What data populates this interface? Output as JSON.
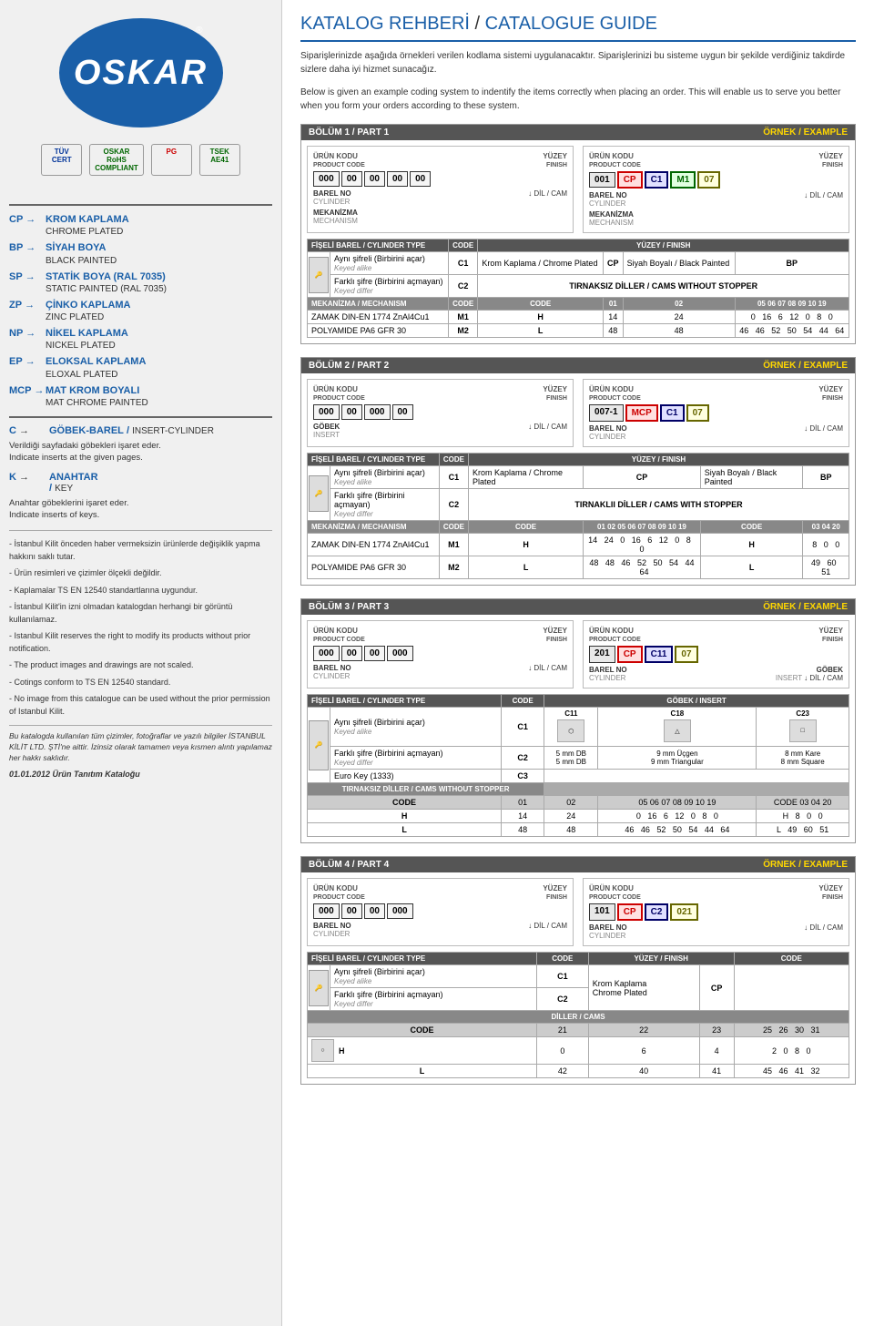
{
  "sidebar": {
    "logo": "OSKAR",
    "logo_reg": "®",
    "certs": [
      {
        "label": "TÜV\nCERT",
        "class": "tuv"
      },
      {
        "label": "OSKAR\nRoHS\nCOMPLIANT",
        "class": "rohs"
      },
      {
        "label": "PG",
        "class": "pg"
      },
      {
        "label": "TSEK\nAE41",
        "class": "tsek"
      }
    ],
    "abbreviations": [
      {
        "code": "CP",
        "tr": "KROM KAPLAMA",
        "en": "CHROME PLATED"
      },
      {
        "code": "BP",
        "tr": "SİYAH BOYA",
        "en": "BLACK PAINTED"
      },
      {
        "code": "SP",
        "tr": "STATİK BOYA (RAL 7035)",
        "en": "STATIC PAINTED (RAL 7035)"
      },
      {
        "code": "ZP",
        "tr": "ÇİNKO KAPLAMA",
        "en": "ZINC PLATED"
      },
      {
        "code": "NP",
        "tr": "NİKEL KAPLAMA",
        "en": "NICKEL PLATED"
      },
      {
        "code": "EP",
        "tr": "ELOKSAL KAPLAMA",
        "en": "ELOXAL PLATED"
      },
      {
        "code": "MCP",
        "tr": "MAT KROM BOYALI",
        "en": "MAT CHROME PAINTED"
      }
    ],
    "insert_code": "C",
    "insert_tr": "GÖBEK-BAREL",
    "insert_en": "INSERT-CYLINDER",
    "insert_desc_tr": "Verildiği sayfadaki göbekleri işaret eder.",
    "insert_desc_en": "Indicate inserts at the given pages.",
    "key_code": "K",
    "key_tr": "ANAHTAR",
    "key_slash": "/",
    "key_en": "KEY",
    "key_desc_tr": "Anahtar göbeklerini işaret eder.",
    "key_desc_en": "Indicate inserts of keys.",
    "info_lines": [
      "- İstanbul Kilit önceden haber vermeksizin ürünlerde değişiklik yapma hakkını saklı tutar.",
      "- Ürün resimleri ve çizimler ölçekli değildir.",
      "- Kaplamalar TS EN 12540 standartlarına uygundur.",
      "- İstanbul Kilit'in izni olmadan katalogdan herhangi bir görüntü kullanılamaz.",
      "- Istanbul Kilit reserves the right to modify its products without prior notification.",
      "- The product images and drawings are not scaled.",
      "- Cotings conform to TS EN 12540 standard.",
      "- No image from this catalogue can be used without the prior permission of Istanbul Kilit."
    ],
    "footer_italic": "Bu katalogda kullanılan tüm çizimler, fotoğraflar ve yazılı bilgiler İSTANBUL KİLİT LTD. ŞTİ'ne aittir. İzinsiz olarak tamamen veya kısmen alıntı yapılamaz her hakkı saklıdır.",
    "footer_date": "01.01.2012 Ürün Tanıtım Kataloğu"
  },
  "main": {
    "title": "KATALOG REHBERİ",
    "title_slash": "/",
    "title_en": "CATALOGUE GUIDE",
    "intro1": "Siparişlerinizde aşağıda örnekleri verilen kodlama sistemi uygulanacaktır. Siparişlerinizi bu sisteme uygun bir şekilde verdiğiniz takdirde sizlere daha iyi hizmet sunacağız.",
    "intro2": "Below is given an example coding system to indentify the items correctly when placing an order. This will enable us to serve you better when you form your orders according to these system.",
    "sections": [
      {
        "id": "bolum1",
        "title": "BÖLÜM 1 / PART 1",
        "example_label": "ÖRNEK / EXAMPLE",
        "left_diagram": {
          "product_code_label": "ÜRÜN KODU",
          "product_code_en": "PRODUCT CODE",
          "finish_label": "YÜZEY",
          "finish_en": "FINISH",
          "boxes": [
            "000",
            "00",
            "00",
            "00",
            "00"
          ],
          "cylinder_label": "BAREL NO",
          "cylinder_en": "CYLINDER",
          "dil_label": "DİL / CAM",
          "mechanism_label": "MEKANİZMA",
          "mechanism_en": "MECHANISM"
        },
        "right_diagram": {
          "product_code_label": "ÜRÜN KODU",
          "product_code_en": "PRODUCT CODE",
          "finish_label": "YÜZEY",
          "finish_en": "FINISH",
          "boxes": [
            "001",
            "CP",
            "C1",
            "M1",
            "07"
          ],
          "cylinder_label": "BAREL NO",
          "cylinder_en": "CYLINDER",
          "dil_label": "DİL / CAM",
          "mechanism_label": "MEKANİZMA",
          "mechanism_en": "MECHANISM"
        },
        "cylinder_table": {
          "header": "FİŞELİ BAREL / CYLINDER TYPE",
          "code_col": "CODE",
          "finish_col": "YÜZEY / FINISH",
          "rows": [
            {
              "type_tr": "Aynı şifreli (Birbirini açar)",
              "type_en": "Keyed alike",
              "code": "C1",
              "finish_tr": "Krom Kaplama / Chrome Plated",
              "finish_code": "CP",
              "finish2_tr": "Siyah Boyalı / Black Painted",
              "finish2_code": "BP"
            },
            {
              "type_tr": "Farklı şifre (Birbirini açmayan)",
              "type_en": "Keyed differ",
              "code": "C2",
              "finish_span": "TIRNAKSIZ DİLLER / CAMS WITHOUT STOPPER"
            }
          ]
        },
        "mechanism_table": {
          "header": "MEKANİZMA / MECHANISM",
          "code_col": "CODE",
          "rows": [
            {
              "name": "ZAMAK DIN-EN 1774 ZnAl4Cu1",
              "code": "M1"
            },
            {
              "name": "POLYAMIDE PA6 GFR 30",
              "code": "M2"
            }
          ]
        },
        "cam_table": {
          "header1": "CODE",
          "cols1": [
            "01",
            "02",
            "05",
            "06",
            "07",
            "08",
            "09",
            "10",
            "19"
          ],
          "h_row": [
            "H",
            "14",
            "24",
            "0",
            "16",
            "6",
            "12",
            "0",
            "8",
            "0"
          ],
          "l_row": [
            "L",
            "48",
            "48",
            "46",
            "46",
            "52",
            "50",
            "54",
            "44",
            "64"
          ]
        }
      },
      {
        "id": "bolum2",
        "title": "BÖLÜM 2 / PART 2",
        "example_label": "ÖRNEK / EXAMPLE",
        "left_diagram": {
          "insert_label": "GÖBEK",
          "insert_en": "INSERT",
          "boxes": [
            "000",
            "00",
            "000",
            "00"
          ],
          "dil_label": "DİL / CAM"
        },
        "right_diagram": {
          "cylinder_label": "BAREL NO",
          "cylinder_en": "CYLINDER",
          "boxes": [
            "007-1",
            "MCP",
            "C1",
            "07"
          ],
          "dil_label": "DİL / CAM"
        },
        "cam_table_with_stopper": {
          "header": "TIRNAKLII DİLLER / CAMS WITH STOPPER",
          "cols": [
            "01",
            "02",
            "05",
            "06",
            "07",
            "08",
            "09",
            "10",
            "19"
          ],
          "extra_cols": [
            "03",
            "04",
            "20"
          ],
          "h_row": [
            "H",
            "14",
            "24",
            "0",
            "16",
            "6",
            "12",
            "0",
            "8",
            "0"
          ],
          "h_extra": [
            "H",
            "8",
            "0",
            "0"
          ],
          "l_row": [
            "L",
            "48",
            "48",
            "46",
            "52",
            "50",
            "54",
            "44",
            "64"
          ],
          "l_extra": [
            "L",
            "49",
            "60",
            "51"
          ]
        }
      },
      {
        "id": "bolum3",
        "title": "BÖLÜM 3 / PART 3",
        "example_label": "ÖRNEK / EXAMPLE",
        "right_diagram_boxes": [
          "201",
          "CP",
          "C11",
          "07"
        ],
        "gobek_codes": [
          "C11",
          "C18",
          "C23"
        ],
        "gobek_labels": [
          "5 mm DB\n5 mm DB",
          "9 mm Üçgen\n9 mm Triangular",
          "8 mm Kare\n8 mm Square"
        ],
        "euro_key": "Euro Key (1333)",
        "euro_code": "C3"
      },
      {
        "id": "bolum4",
        "title": "BÖLÜM 4 / PART 4",
        "example_label": "ÖRNEK / EXAMPLE",
        "right_diagram_boxes": [
          "101",
          "CP",
          "C2",
          "021"
        ],
        "finish_rows": [
          {
            "type_tr": "Aynı şifreli (Birbirini açar)",
            "type_en": "Keyed alike",
            "code": "C1",
            "finish_tr": "Krom Kaplama",
            "finish_en": "Chrome Plated",
            "finish_code": "CP"
          },
          {
            "type_tr": "Farklı şifre (Birbirini açmayan)",
            "type_en": "Keyed differ",
            "code": "C2"
          }
        ],
        "cam_section": "DİLLER / CAMS",
        "cam_cols": [
          "CODE",
          "21",
          "22",
          "23",
          "25",
          "26",
          "30",
          "31"
        ],
        "cam_h": [
          "H",
          "0",
          "6",
          "4",
          "2",
          "0",
          "8",
          "0"
        ],
        "cam_l": [
          "L",
          "42",
          "40",
          "41",
          "45",
          "46",
          "41",
          "32"
        ]
      }
    ]
  }
}
